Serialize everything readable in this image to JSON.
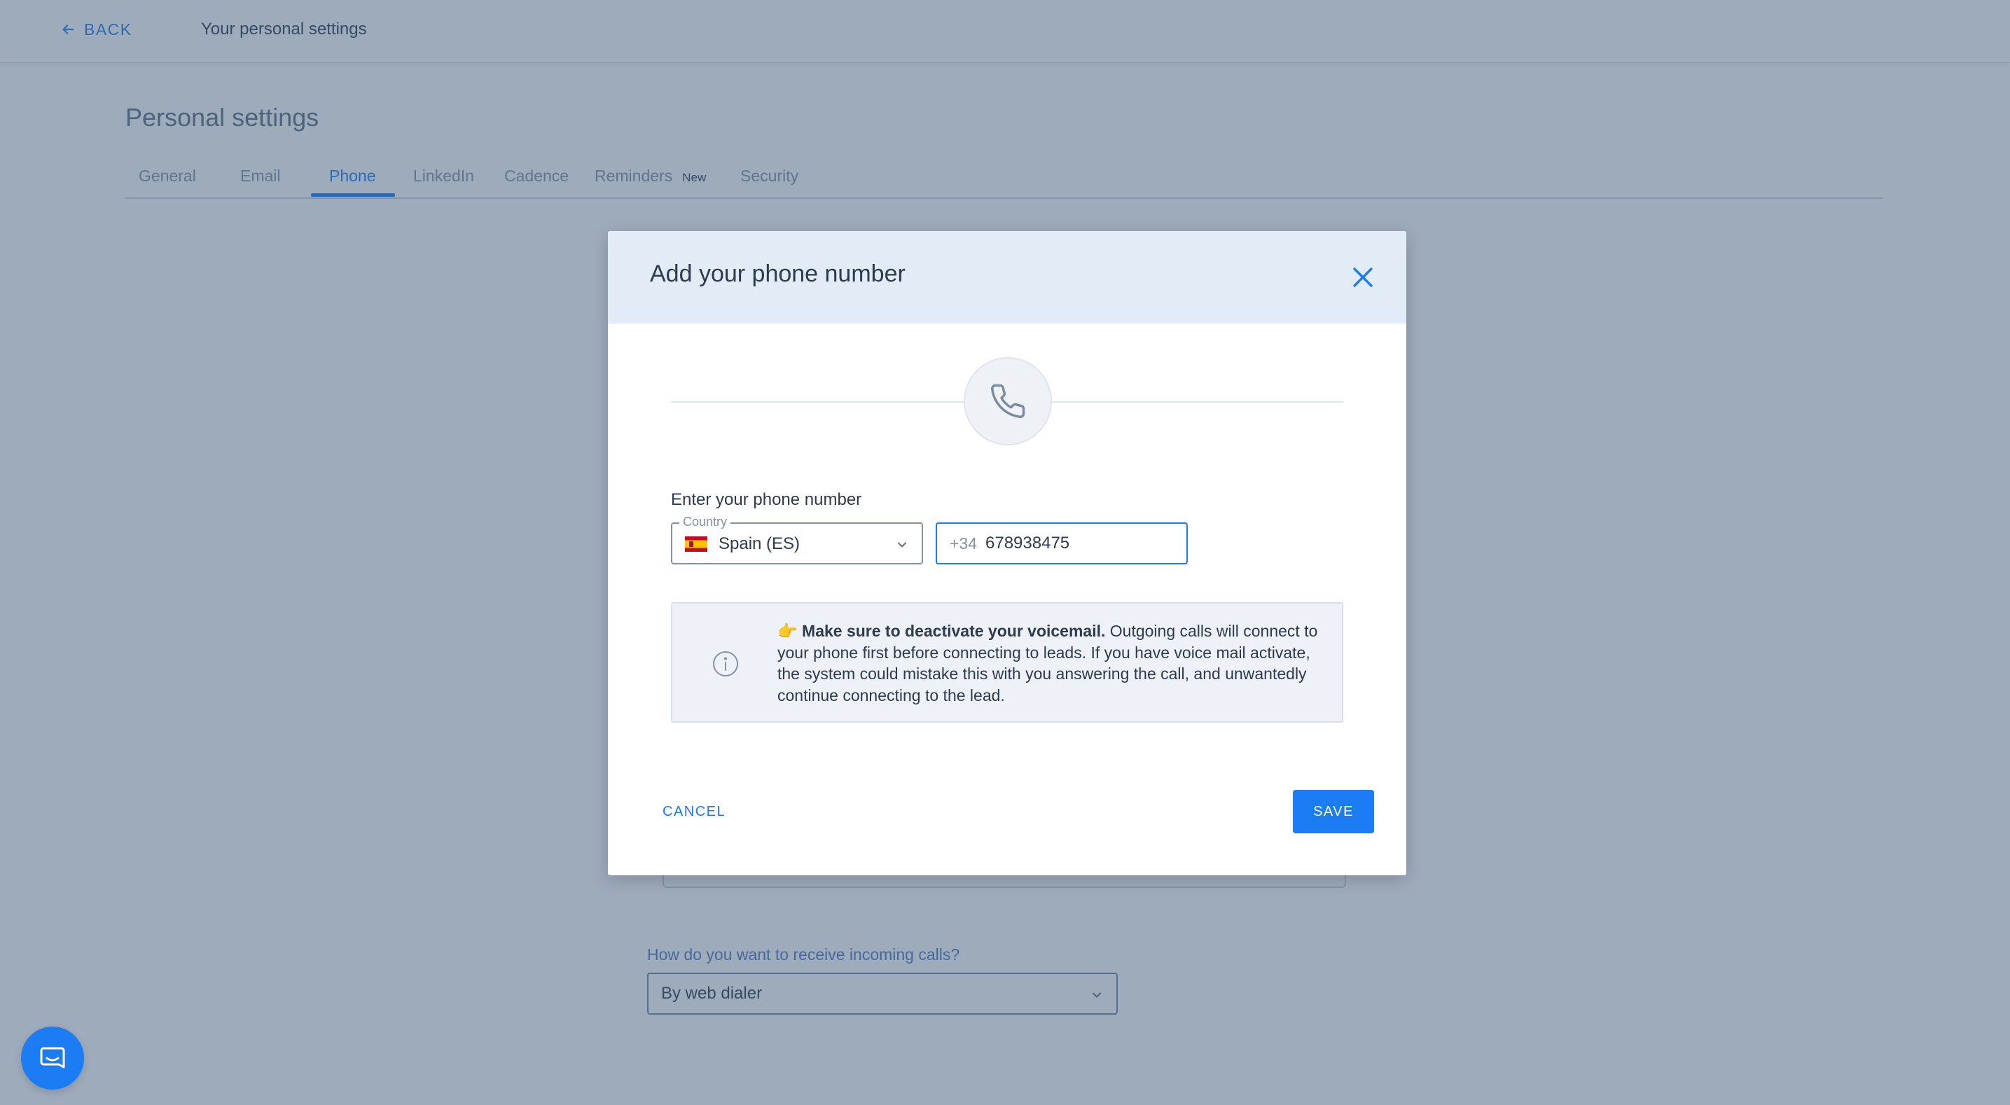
{
  "topbar": {
    "back_label": "BACK",
    "title": "Your personal settings"
  },
  "settings": {
    "page_title": "Personal settings",
    "tabs": [
      {
        "label": "General"
      },
      {
        "label": "Email"
      },
      {
        "label": "Phone",
        "active": true
      },
      {
        "label": "LinkedIn"
      },
      {
        "label": "Cadence"
      },
      {
        "label": "Reminders",
        "badge": "New"
      },
      {
        "label": "Security"
      }
    ],
    "incoming_calls_question": "How do you want to receive incoming calls?",
    "incoming_calls_value": "By web dialer"
  },
  "modal": {
    "title": "Add your phone number",
    "phone_label": "Enter your phone number",
    "country_legend": "Country",
    "country_value": "Spain (ES)",
    "dial_prefix": "+34",
    "phone_value": "678938475",
    "info_bold": "Make sure to deactivate your voicemail.",
    "info_text": " Outgoing calls will connect to your phone first before connecting to leads. If you have voice mail activate, the system could mistake this with you answering the call, and unwantedly continue connecting to the lead.",
    "info_emoji": "👉",
    "cancel_label": "CANCEL",
    "save_label": "SAVE"
  },
  "colors": {
    "accent": "#1c7cf4",
    "overlay": "#3e5878",
    "modal_header": "#e2ecf7"
  },
  "icons": {
    "back": "arrow-left-icon",
    "close": "close-icon",
    "phone": "phone-icon",
    "info": "info-icon",
    "chevron": "chevron-down-icon",
    "chat": "chat-icon",
    "flag": "spain-flag-icon"
  }
}
